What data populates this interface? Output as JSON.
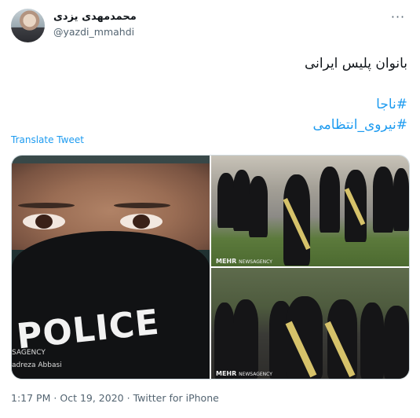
{
  "user": {
    "name": "محمدمهدی یزدی",
    "handle": "@yazdi_mmahdi"
  },
  "more_menu": "···",
  "tweet": {
    "text": "بانوان پلیس ایرانی",
    "hashtags": [
      "#ناجا",
      "#نیروی_انتظامی"
    ]
  },
  "translate_link": "Translate Tweet",
  "media": {
    "main_image": {
      "mask_text": "POLICE",
      "credit_agency": "SAGENCY",
      "credit_photographer": "adreza Abbasi"
    },
    "watermark": {
      "brand": "MEHR",
      "sub": "NEWSAGENCY"
    }
  },
  "meta": {
    "time": "1:17 PM",
    "date": "Oct 19, 2020",
    "separator": "·",
    "source": "Twitter for iPhone"
  },
  "colors": {
    "link": "#1d9bf0",
    "secondary_text": "#536471"
  }
}
